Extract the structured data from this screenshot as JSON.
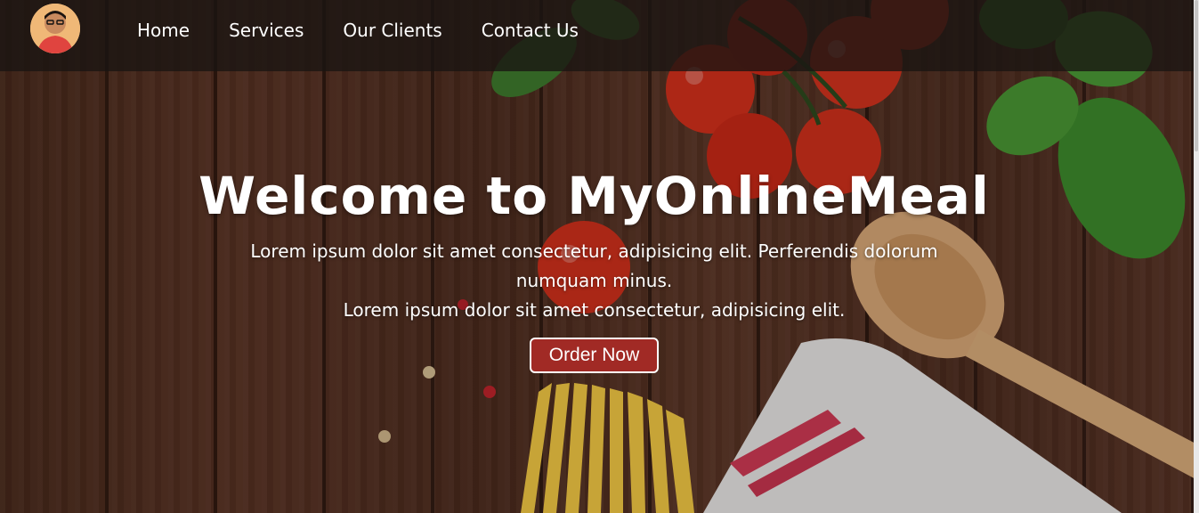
{
  "navbar": {
    "links": [
      {
        "label": "Home"
      },
      {
        "label": "Services"
      },
      {
        "label": "Our Clients"
      },
      {
        "label": "Contact Us"
      }
    ]
  },
  "hero": {
    "title": "Welcome to MyOnlineMeal",
    "paragraph_line1": "Lorem ipsum dolor sit amet consectetur, adipisicing elit. Perferendis dolorum numquam minus.",
    "paragraph_line2": "Lorem ipsum dolor sit amet consectetur, adipisicing elit.",
    "cta_label": "Order Now"
  },
  "colors": {
    "button_bg": "#a12a25",
    "navbar_bg": "#191412",
    "text": "#ffffff"
  }
}
